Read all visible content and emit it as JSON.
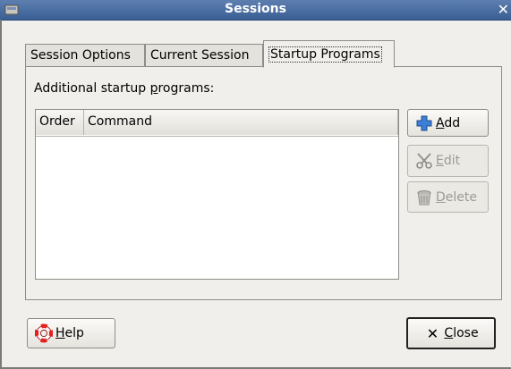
{
  "window": {
    "title": "Sessions"
  },
  "tabs": [
    {
      "label": "Session Options"
    },
    {
      "label": "Current Session"
    },
    {
      "label": "Startup Programs"
    }
  ],
  "panel": {
    "label_before": "Additional startup ",
    "label_mnemonic": "p",
    "label_after": "rograms:",
    "columns": [
      {
        "label": "Order"
      },
      {
        "label": "Command"
      }
    ],
    "rows": []
  },
  "buttons": {
    "add": {
      "mnemonic": "A",
      "rest": "dd",
      "icon": "plus-icon",
      "enabled": true
    },
    "edit": {
      "mnemonic": "E",
      "rest": "dit",
      "icon": "scissors-icon",
      "enabled": false
    },
    "delete": {
      "mnemonic": "D",
      "rest": "elete",
      "icon": "trash-icon",
      "enabled": false
    },
    "help": {
      "mnemonic": "H",
      "rest": "elp",
      "icon": "lifebuoy-icon"
    },
    "close": {
      "mnemonic": "C",
      "rest": "lose",
      "icon": "close-x-icon"
    }
  },
  "colors": {
    "titlebar": "#3a5f94",
    "accent_plus": "#3d7ed6"
  }
}
